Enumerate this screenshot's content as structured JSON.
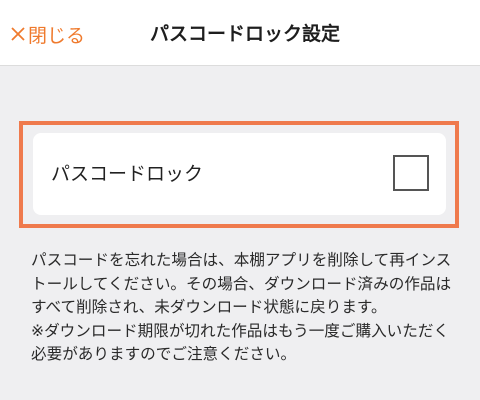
{
  "header": {
    "close_label": "閉じる",
    "title": "パスコードロック設定"
  },
  "setting": {
    "label": "パスコードロック",
    "checked": false
  },
  "note": {
    "paragraph1": "パスコードを忘れた場合は、本棚アプリを削除して再インストールしてください。その場合、ダウンロード済みの作品はすべて削除され、未ダウンロード状態に戻ります。",
    "paragraph2": "※ダウンロード期限が切れた作品はもう一度ご購入いただく必要がありますのでご注意ください。"
  },
  "colors": {
    "accent": "#ef7a2d",
    "highlight_border": "#ef7a4d",
    "background": "#efeff1"
  }
}
